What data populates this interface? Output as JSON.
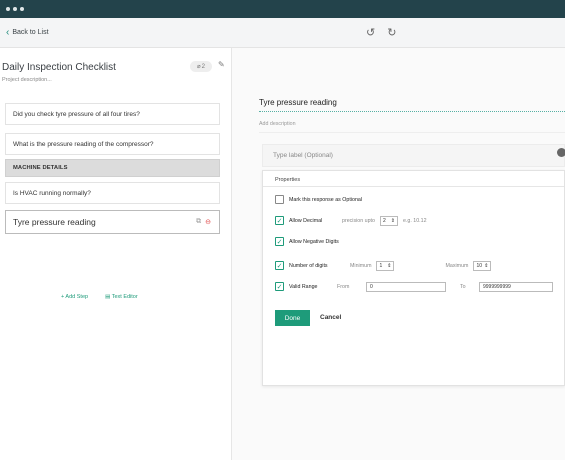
{
  "window": {
    "controls": [
      "dot",
      "dot",
      "dot"
    ]
  },
  "nav": {
    "back_label": "Back to List",
    "undo_icon": "undo-icon",
    "redo_icon": "redo-icon"
  },
  "checklist": {
    "title": "Daily Inspection Checklist",
    "description": "Project description...",
    "attachment_count": "2",
    "steps": [
      {
        "label": "Did you check tyre pressure of all four tires?"
      },
      {
        "label": "What is the pressure reading of the compressor?"
      },
      {
        "label": "MACHINE DETAILS"
      },
      {
        "label": "Is HVAC running normally?"
      },
      {
        "label": "Tyre pressure reading"
      }
    ],
    "add_step": "+ Add Step",
    "text_editor": "Text Editor"
  },
  "editor": {
    "question_title": "Tyre pressure reading",
    "add_description": "Add description",
    "type_label_placeholder": "Type label (Optional)",
    "properties": {
      "header": "Properties",
      "optional": {
        "label": "Mark this response as Optional",
        "checked": false
      },
      "allow_decimal": {
        "label": "Allow Decimal",
        "checked": true,
        "precision_label": "precision upto",
        "precision_value": "2",
        "example": "e.g. 10.12"
      },
      "allow_negative": {
        "label": "Allow Negative Digits",
        "checked": true
      },
      "num_digits": {
        "label": "Number of digits",
        "checked": true,
        "min_label": "Minimum",
        "min_value": "1",
        "max_label": "Maximum",
        "max_value": "10"
      },
      "valid_range": {
        "label": "Valid Range",
        "checked": true,
        "from_label": "From",
        "from_value": "0",
        "to_label": "To",
        "to_value": "9999999999"
      }
    },
    "done_label": "Done",
    "cancel_label": "Cancel"
  },
  "colors": {
    "topbar": "#23434b",
    "accent": "#1e9b7a",
    "delete": "#e05050"
  }
}
